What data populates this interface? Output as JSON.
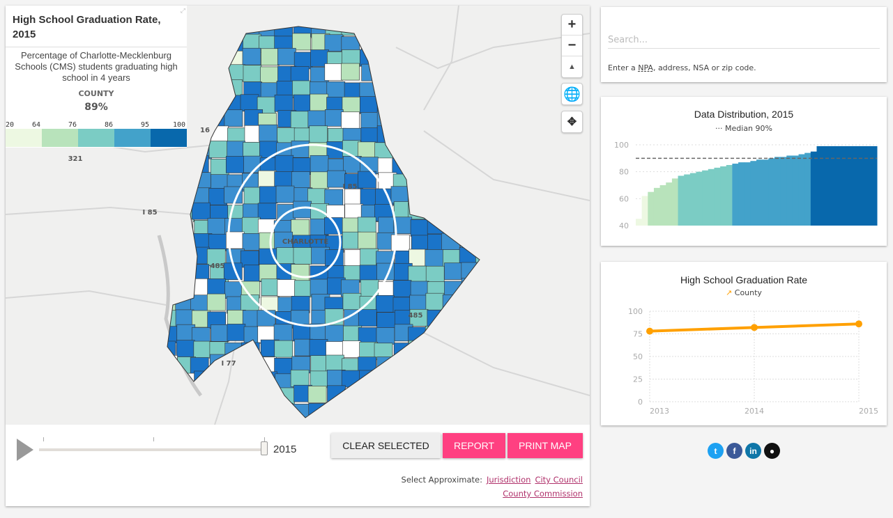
{
  "legend": {
    "title": "High School Graduation Rate, 2015",
    "description": "Percentage of Charlotte-Mecklenburg Schools (CMS) students graduating high school in 4 years",
    "county_label": "COUNTY",
    "county_value": "89%",
    "breaks": [
      "20",
      "64",
      "76",
      "86",
      "95",
      "100"
    ],
    "colors": [
      "#edf8e2",
      "#b8e3bb",
      "#7bccc4",
      "#43a2ca",
      "#0868ac"
    ]
  },
  "map": {
    "labels": [
      "CHARLOTTE",
      "16",
      "321",
      "I 85",
      "485",
      "I 85",
      "I 77",
      "485"
    ],
    "controls": {
      "zoom_in": "+",
      "zoom_out": "−",
      "north": "▲"
    }
  },
  "timeline": {
    "year": "2015",
    "years": [
      "2013",
      "2014",
      "2015"
    ]
  },
  "buttons": {
    "clear": "CLEAR SELECTED",
    "report": "REPORT",
    "print": "PRINT MAP"
  },
  "select": {
    "label": "Select Approximate:",
    "links": [
      "Jurisdiction",
      "City Council",
      "County Commission"
    ]
  },
  "search": {
    "placeholder": "Search...",
    "hint_pre": "Enter a ",
    "hint_abbr": "NPA",
    "hint_post": ", address, NSA or zip code."
  },
  "chart_data": [
    {
      "type": "area",
      "title": "Data Distribution, 2015",
      "legend": "Median 90%",
      "median": 90,
      "ylim": [
        40,
        100
      ],
      "yticks": [
        40,
        60,
        80,
        100
      ],
      "values": [
        45,
        62,
        65,
        68,
        70,
        72,
        75,
        77,
        78,
        79,
        80,
        81,
        82,
        83,
        84,
        85,
        86,
        87,
        87,
        88,
        89,
        89,
        90,
        91,
        91,
        92,
        92,
        93,
        94,
        95,
        99,
        99,
        99,
        99,
        99,
        99,
        99,
        99,
        99,
        99
      ]
    },
    {
      "type": "line",
      "title": "High School Graduation Rate",
      "categories": [
        "2013",
        "2014",
        "2015"
      ],
      "series": [
        {
          "name": "County",
          "values": [
            78,
            82,
            86
          ]
        }
      ],
      "ylim": [
        0,
        100
      ],
      "yticks": [
        0,
        25,
        50,
        75,
        100
      ],
      "color": "#ffa000"
    }
  ],
  "social": [
    "twitter",
    "facebook",
    "linkedin",
    "github"
  ],
  "accent": "#ff4081"
}
